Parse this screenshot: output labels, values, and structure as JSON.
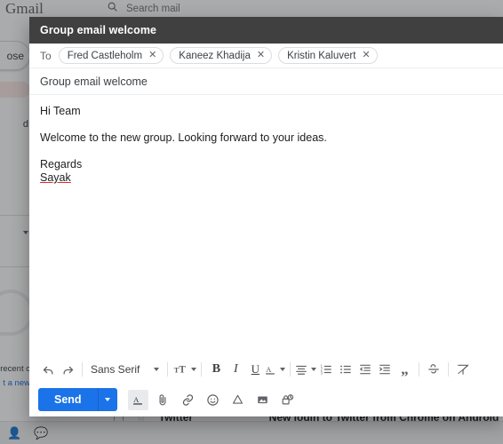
{
  "background": {
    "logo": "Gmail",
    "search_placeholder": "Search mail",
    "search_icon": "search-icon",
    "compose_label": "ose",
    "nav_items": [
      {
        "label": "",
        "icon": "inbox-icon"
      },
      {
        "label": "d",
        "icon": "snoozed-icon"
      }
    ],
    "hangouts": {
      "line1": "recent c",
      "line2": "t a new"
    },
    "bottom_icons": [
      "contacts-icon",
      "hangouts-icon"
    ],
    "mail_row": {
      "sender": "Twitter",
      "subject": "New login to Twitter from Chrome on Android",
      "star_icon": "star-outline-icon",
      "checkbox_icon": "checkbox-icon"
    }
  },
  "compose": {
    "title": "Group email welcome",
    "to": {
      "label": "To",
      "recipients": [
        {
          "name": "Fred Castleholm",
          "remove_icon": "close-icon"
        },
        {
          "name": "Kaneez Khadija",
          "remove_icon": "close-icon"
        },
        {
          "name": "Kristin Kaluvert",
          "remove_icon": "close-icon"
        }
      ]
    },
    "subject": "Group email welcome",
    "body": {
      "greeting": "Hi Team",
      "paragraph": "Welcome to the new group. Looking forward to your ideas.",
      "signoff": "Regards",
      "signature": "Sayak"
    },
    "format_toolbar": {
      "undo": "undo-icon",
      "redo": "redo-icon",
      "font_family": "Sans Serif",
      "font_size": "font-size-icon",
      "bold": "B",
      "italic": "I",
      "underline": "U",
      "text_color": "text-color-icon",
      "align": "align-icon",
      "numbered_list": "numbered-list-icon",
      "bulleted_list": "bulleted-list-icon",
      "indent_less": "indent-less-icon",
      "indent_more": "indent-more-icon",
      "quote": "quote-icon",
      "strikethrough": "strikethrough-icon",
      "remove_format": "remove-format-icon"
    },
    "send_bar": {
      "send_label": "Send",
      "send_caret": "chevron-down-icon",
      "formatting_options": "formatting-options-icon",
      "attach_file": "paperclip-icon",
      "insert_link": "link-icon",
      "insert_emoji": "emoji-icon",
      "insert_drive": "google-drive-icon",
      "insert_photo": "image-icon",
      "confidential_mode": "confidential-lock-icon"
    }
  },
  "colors": {
    "accent": "#1a73e8",
    "titlebar": "#404040",
    "chip_border": "#dadce0",
    "spellcheck": "#d93025"
  }
}
